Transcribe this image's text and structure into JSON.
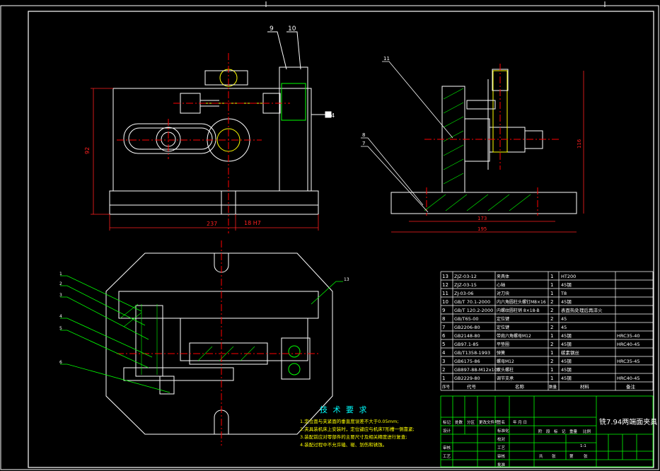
{
  "drawing": {
    "colors": {
      "background": "#000000",
      "outline": "#ffffff",
      "center_line": "#ff0000",
      "dimension": "#ff2020",
      "hatch": "#00ff00",
      "title_text": "#ffffff",
      "leader": "#00ff00",
      "accent": "#ffff00",
      "cyan": "#00ffff"
    },
    "front_view": {
      "balloon_9": "9",
      "balloon_10": "10",
      "dim_height": "92",
      "dim_width": "237",
      "dim_fit": "18 H7",
      "dim_side": "4"
    },
    "side_view": {
      "balloon_11": "11",
      "balloon_8": "8",
      "balloon_7": "7",
      "dim_inner": "173",
      "dim_outer": "195",
      "dim_height": "116"
    },
    "top_view": {
      "balloons": [
        "1",
        "2",
        "3",
        "4",
        "5",
        "6"
      ],
      "balloon_right": "13"
    },
    "tech_requirements": {
      "title": "技 术 要 求",
      "lines": [
        "1.定位面与夹紧面的垂直度误差不大于0.05mm;",
        "2.夹具装机床上安装时，定位键应与机床T形槽一侧靠紧;",
        "3.装配前应对零部件的主要尺寸及相关精度进行复查;",
        "4.装配过程中不允许磕、碰、划伤和锈蚀。"
      ]
    },
    "bom": {
      "rows": [
        {
          "no": "13",
          "code": "ZJZ-03-12",
          "name": "夹具体",
          "qty": "1",
          "material": "HT200",
          "remark": ""
        },
        {
          "no": "12",
          "code": "ZJZ-03-15",
          "name": "心轴",
          "qty": "1",
          "material": "45钢",
          "remark": ""
        },
        {
          "no": "11",
          "code": "ZJ-03-06",
          "name": "对刀块",
          "qty": "1",
          "material": "T8",
          "remark": ""
        },
        {
          "no": "10",
          "code": "GB/T 70.1-2000",
          "name": "内六角圆柱头螺钉M8×16",
          "qty": "2",
          "material": "45钢",
          "remark": ""
        },
        {
          "no": "9",
          "code": "GB/T 120.2-2000",
          "name": "内螺纹圆柱销 8×18-B",
          "qty": "2",
          "material": "表面热处理后再淬火",
          "remark": ""
        },
        {
          "no": "8",
          "code": "GB/T65-00",
          "name": "定位键",
          "qty": "2",
          "material": "45",
          "remark": ""
        },
        {
          "no": "7",
          "code": "GB2206-80",
          "name": "定位键",
          "qty": "2",
          "material": "45",
          "remark": ""
        },
        {
          "no": "6",
          "code": "GB2148-80",
          "name": "带肩六角螺母M12",
          "qty": "1",
          "material": "45钢",
          "remark": "HRC35-40"
        },
        {
          "no": "5",
          "code": "GB97.1-85",
          "name": "平垫圈",
          "qty": "2",
          "material": "45钢",
          "remark": "HRC40-45"
        },
        {
          "no": "4",
          "code": "GB/T1358-1993",
          "name": "弹簧",
          "qty": "1",
          "material": "碳素钢丝",
          "remark": ""
        },
        {
          "no": "3",
          "code": "GB6175-86",
          "name": "螺母M12",
          "qty": "2",
          "material": "45钢",
          "remark": "HRC35-45"
        },
        {
          "no": "2",
          "code": "GB897-88-M12x105",
          "name": "双头螺柱",
          "qty": "1",
          "material": "45钢",
          "remark": ""
        },
        {
          "no": "1",
          "code": "GB2229-80",
          "name": "调节支承",
          "qty": "1",
          "material": "45钢",
          "remark": "HRC40-45"
        }
      ],
      "header": {
        "no": "序号",
        "code": "代号",
        "name": "名称",
        "qty": "数量",
        "material": "材料",
        "remark": "备注"
      }
    },
    "title_block": {
      "drawing_title": "铣7.94两端面夹具",
      "mark_row": [
        "标记",
        "处数",
        "分区",
        "更改文件号",
        "签名",
        "年 月 日"
      ],
      "design_row": [
        "设计",
        "",
        "",
        "标准化"
      ],
      "check_row": [
        "审核",
        "",
        "",
        "工艺"
      ],
      "proc_row": [
        "工艺",
        "",
        "",
        "批准"
      ],
      "stage_row": [
        "阶",
        "段",
        "标",
        "记",
        "重量",
        "比例"
      ],
      "scale": "1:1",
      "sheets": [
        "共",
        "张",
        "第",
        "张"
      ],
      "aux_labels": [
        "校对",
        "审核"
      ]
    }
  }
}
